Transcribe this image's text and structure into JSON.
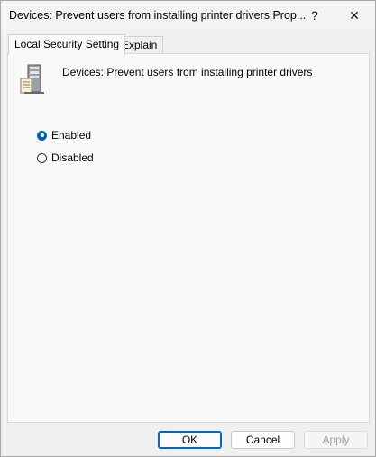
{
  "window": {
    "title": "Devices: Prevent users from installing printer drivers Prop...",
    "help_glyph": "?",
    "close_glyph": "✕"
  },
  "tabs": [
    {
      "label": "Local Security Setting",
      "active": true
    },
    {
      "label": "Explain",
      "active": false
    }
  ],
  "policy": {
    "icon": "server-policy-icon",
    "name": "Devices: Prevent users from installing printer drivers"
  },
  "options": [
    {
      "label": "Enabled",
      "selected": true
    },
    {
      "label": "Disabled",
      "selected": false
    }
  ],
  "buttons": {
    "ok": "OK",
    "cancel": "Cancel",
    "apply": "Apply"
  },
  "colors": {
    "accent": "#0067c0"
  }
}
